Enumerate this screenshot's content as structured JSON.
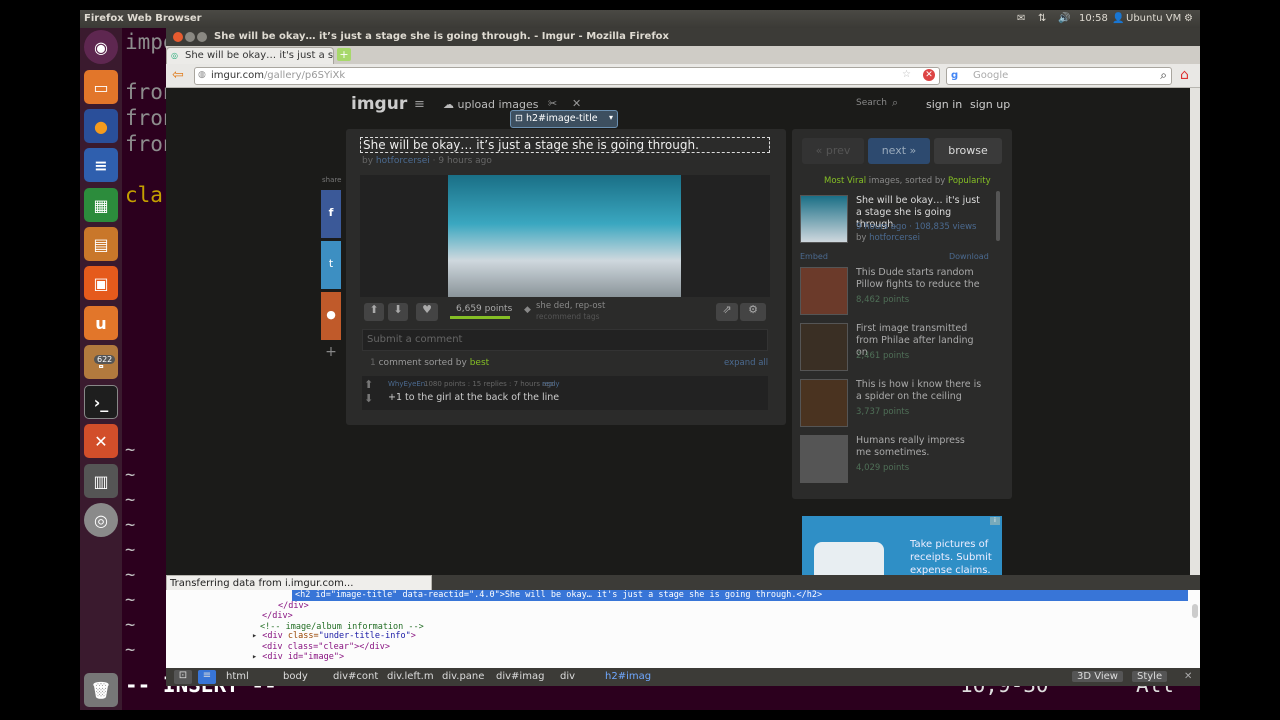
{
  "os": {
    "app_title": "Firefox Web Browser",
    "clock": "10:58",
    "user": "Ubuntu VM",
    "dock_badge": "622"
  },
  "terminal": {
    "lines": [
      "impo",
      "fron",
      "fron",
      "fron",
      "cla"
    ],
    "mode": "-- INSERT --",
    "position": "16,9-30",
    "scroll": "All",
    "tilde": "~"
  },
  "browser": {
    "window_title": "She will be okay… it’s just a stage she is going through. - Imgur - Mozilla Firefox",
    "tab_label": "She will be okay… it's just a st...",
    "url_domain": "imgur.com",
    "url_path": "/gallery/p6SYiXk",
    "search_placeholder": "Google",
    "status": "Transferring data from i.imgur.com..."
  },
  "imgur": {
    "logo": "imgur",
    "upload": "upload images",
    "search": "Search",
    "signin": "sign in",
    "signup": "sign up",
    "inspector_tooltip": "h2#image-title",
    "post_title": "She will be okay… it’s just a stage she is going through.",
    "by": "by",
    "author": "hotforcersei",
    "age": "· 9 hours ago",
    "share_label": "share",
    "points": "6,659 points",
    "tags": "she ded, rep-ost",
    "recommend_tags": "recommend tags",
    "comment_placeholder": "Submit a comment",
    "comment_count": "1",
    "comment_sorted": "comment sorted by",
    "sort_value": "best",
    "expand_all": "expand all",
    "comment": {
      "user": "WhyEyeEn",
      "meta": "1080 points : 15 replies : 7 hours ago",
      "reply": "reply",
      "text": "+1 to the girl at the back of the line"
    },
    "nav": {
      "prev": "« prev",
      "next": "next »",
      "browse": "browse"
    },
    "sidebar_header": {
      "sort": "Most Viral",
      "mid": "images, sorted by",
      "by": "Popularity"
    },
    "sidebar_items": [
      {
        "title": "She will be okay… it's just a stage she is going through.",
        "meta": "9 hours ago · 108,835 views",
        "by": "by",
        "author": "hotforcersei"
      },
      {
        "title": "This Dude starts random Pillow fights to reduce the",
        "meta": "8,462 points"
      },
      {
        "title": "First image transmitted from Philae after landing on",
        "meta": "2,461 points"
      },
      {
        "title": "This is how i know there is a spider on the ceiling",
        "meta": "3,737 points"
      },
      {
        "title": "Humans really impress me sometimes.",
        "meta": "4,029 points"
      }
    ],
    "embed": "Embed",
    "download": "Download",
    "ad_text": "Take pictures of receipts. Submit expense claims."
  },
  "devtools": {
    "sel_line": "<h2 id=\"image-title\" data-reactid=\".4.0\">She will be okay… it's just a stage she is going through.</h2>",
    "l1": "</div>",
    "l2": "</div>",
    "l3": "<!-- image/album information -->",
    "l4_tag": "<div",
    "l4_attr": "class=",
    "l4_val": "\"under-title-info\"",
    "l4_end": ">",
    "l5": "<div class=\"clear\"></div>",
    "l6": "<div id=\"image\">",
    "crumbs": [
      "html",
      "body",
      "div#cont",
      "div.left.m",
      "div.pane",
      "div#imag",
      "div",
      "h2#imag"
    ],
    "btn_3d": "3D View",
    "btn_style": "Style"
  }
}
